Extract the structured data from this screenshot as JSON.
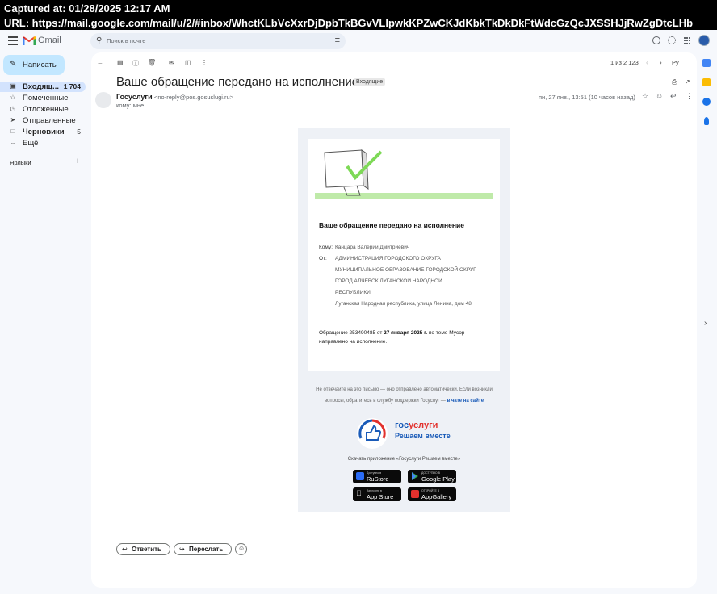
{
  "capture": {
    "timestamp": "Captured at: 01/28/2025 12:17 AM",
    "url": "URL: https://mail.google.com/mail/u/2/#inbox/WhctKLbVcXxrDjDpbTkBGvVLlpwkKPZwCKJdKbkTkDkDkFtWdcGzQcJXSSHJjRwZgDtcLHb"
  },
  "header": {
    "app_name": "Gmail",
    "search_placeholder": "Поиск в почте"
  },
  "nav": {
    "compose": "Написать",
    "items": [
      {
        "label": "Входящ...",
        "count": "1 704",
        "icon": "inbox-icon"
      },
      {
        "label": "Помеченные",
        "count": "",
        "icon": "star-icon"
      },
      {
        "label": "Отложенные",
        "count": "",
        "icon": "clock-icon"
      },
      {
        "label": "Отправленные",
        "count": "",
        "icon": "send-icon"
      },
      {
        "label": "Черновики",
        "count": "5",
        "icon": "draft-icon"
      },
      {
        "label": "Ещё",
        "count": "",
        "icon": "chevron-down-icon"
      }
    ],
    "labels_header": "Ярлыки"
  },
  "toolbar": {
    "pager": "1 из 2 123",
    "lang": "Ру"
  },
  "email": {
    "subject": "Ваше обращение передано на исполнение",
    "tag": "Входящие",
    "sender_name": "Госуслуги",
    "sender_email": "<no-reply@pos.gosuslugi.ru>",
    "to": "кому: мне",
    "date": "пн, 27 янв., 13:51 (10 часов назад)"
  },
  "body": {
    "title": "Ваше обращение передано на исполнение",
    "to_label": "Кому:",
    "to_value": "Канцара Валерий Дмитриевич",
    "from_label": "От:",
    "from_lines": [
      "АДМИНИСТРАЦИЯ ГОРОДСКОГО ОКРУГА",
      "МУНИЦИПАЛЬНОЕ ОБРАЗОВАНИЕ ГОРОДСКОЙ ОКРУГ",
      "ГОРОД АЛЧЕВСК ЛУГАНСКОЙ НАРОДНОЙ",
      "РЕСПУБЛИКИ"
    ],
    "from_address": "Луганская Народная республика, улица Ленина, дом 48",
    "para_prefix": "Обращение 253490485 от ",
    "para_date": "27 января 2025 г.",
    "para_suffix": " по теме Мусор направлено на исполнение.",
    "footer_line1": "Не отвечайте на это письмо — оно отправлено автоматически. Если возникли",
    "footer_line2": "вопросы, обратитесь в службу поддержки Госуслуг — ",
    "footer_link": "в чате на сайте",
    "brand_gos": "гос",
    "brand_uslugi": "услуги",
    "brand_slogan": "Решаем вместе",
    "download_text": "Скачать приложение «Госуслуги Решаем вместе»",
    "stores": [
      {
        "top": "Доступно в",
        "name": "RuStore",
        "color": "#2b6cf6"
      },
      {
        "top": "ДОСТУПНО В",
        "name": "Google Play",
        "color": "#34a853"
      },
      {
        "top": "Загрузите в",
        "name": "App Store",
        "color": "#ffffff"
      },
      {
        "top": "ОТКРОЙТЕ В",
        "name": "AppGallery",
        "color": "#e2312d"
      }
    ]
  },
  "actions": {
    "reply": "Ответить",
    "forward": "Переслать"
  }
}
